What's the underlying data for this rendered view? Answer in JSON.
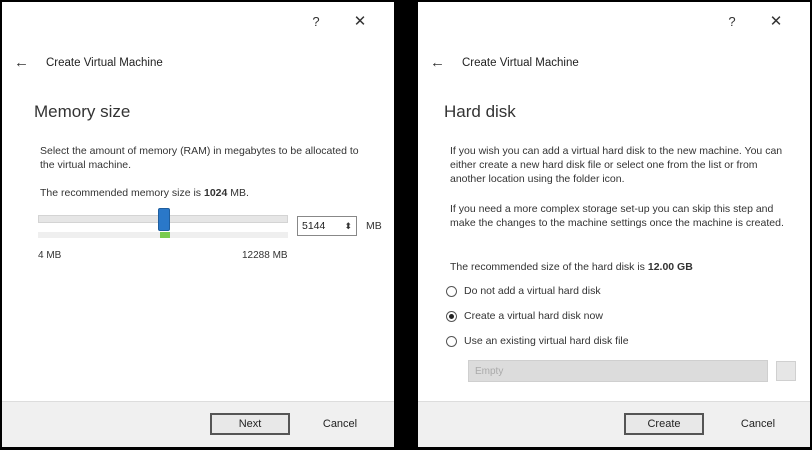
{
  "dialogs": {
    "memory": {
      "help_label": "?",
      "close_label": "✕",
      "back_label": "←",
      "header_title": "Create Virtual Machine",
      "heading": "Memory size",
      "description": "Select the amount of memory (RAM) in megabytes to be allocated to the virtual machine.",
      "recommended_prefix": "The recommended memory size is",
      "recommended_value": "1024",
      "recommended_unit": "MB.",
      "memory_value": "5144",
      "memory_fraction": 0.42,
      "unit": "MB",
      "range_min": "4 MB",
      "range_max": "12288 MB",
      "next_label": "Next",
      "cancel_label": "Cancel"
    },
    "harddisk": {
      "help_label": "?",
      "close_label": "✕",
      "back_label": "←",
      "header_title": "Create Virtual Machine",
      "heading": "Hard disk",
      "paragraph1": "If you wish you can add a virtual hard disk to the new machine. You can either create a new hard disk file or select one from the list or from another location using the folder icon.",
      "paragraph2": "If you need a more complex storage set-up you can skip this step and make the changes to the machine settings once the machine is created.",
      "recommended_prefix": "The recommended size of the hard disk is",
      "recommended_value": "12.00 GB",
      "options": [
        {
          "label": "Do not add a virtual hard disk",
          "checked": false
        },
        {
          "label": "Create a virtual hard disk now",
          "checked": true
        },
        {
          "label": "Use an existing virtual hard disk file",
          "checked": false
        }
      ],
      "file_placeholder": "Empty",
      "create_label": "Create",
      "cancel_label": "Cancel"
    }
  }
}
